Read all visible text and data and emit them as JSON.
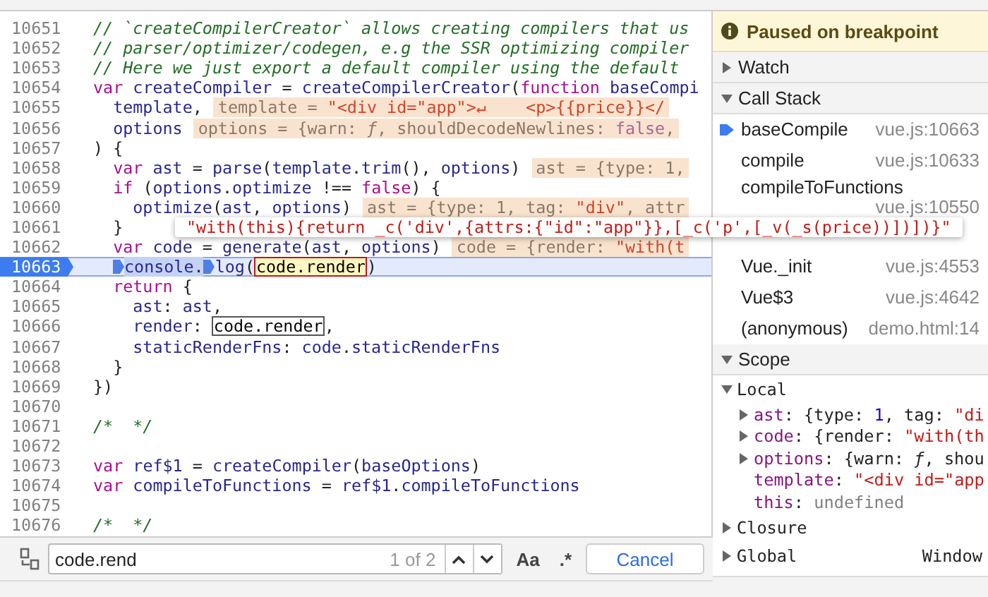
{
  "editor": {
    "lines": [
      {
        "number": "10651",
        "paused": false,
        "segments": [
          {
            "kind": "code",
            "tokens": [
              {
                "kind": "comment",
                "text": "// `createCompilerCreator` allows creating compilers that us"
              }
            ]
          }
        ]
      },
      {
        "number": "10652",
        "paused": false,
        "segments": [
          {
            "kind": "code",
            "tokens": [
              {
                "kind": "comment",
                "text": "// parser/optimizer/codegen, e.g the SSR optimizing compiler"
              }
            ]
          }
        ]
      },
      {
        "number": "10653",
        "paused": false,
        "segments": [
          {
            "kind": "code",
            "tokens": [
              {
                "kind": "comment",
                "text": "// Here we just export a default compiler using the default"
              }
            ]
          }
        ]
      },
      {
        "number": "10654",
        "paused": false,
        "segments": [
          {
            "kind": "code",
            "tokens": [
              {
                "kind": "keyword",
                "text": "var"
              },
              {
                "kind": "name",
                "text": " createCompiler"
              },
              {
                "kind": "plain",
                "text": " = "
              },
              {
                "kind": "name",
                "text": "createCompilerCreator"
              },
              {
                "kind": "plain",
                "text": "("
              },
              {
                "kind": "keyword",
                "text": "function"
              },
              {
                "kind": "name",
                "text": " baseCompi"
              }
            ]
          }
        ]
      },
      {
        "number": "10655",
        "paused": false,
        "segments": [
          {
            "kind": "code",
            "tokens": [
              {
                "kind": "name",
                "text": "  template"
              },
              {
                "kind": "plain",
                "text": ","
              }
            ]
          },
          {
            "kind": "hint",
            "tokens": [
              {
                "kind": "label",
                "text": "template = "
              },
              {
                "kind": "string",
                "text": "\"<div id=\"app\">↵    <p>{{price}}</"
              }
            ]
          }
        ]
      },
      {
        "number": "10656",
        "paused": false,
        "segments": [
          {
            "kind": "code",
            "tokens": [
              {
                "kind": "name",
                "text": "  options"
              }
            ]
          },
          {
            "kind": "hint",
            "tokens": [
              {
                "kind": "label",
                "text": "options = {warn: "
              },
              {
                "kind": "fn",
                "text": "ƒ"
              },
              {
                "kind": "label",
                "text": ", shouldDecodeNewlines: "
              },
              {
                "kind": "literal",
                "text": "false"
              },
              {
                "kind": "label",
                "text": ","
              }
            ]
          }
        ]
      },
      {
        "number": "10657",
        "paused": false,
        "segments": [
          {
            "kind": "code",
            "tokens": [
              {
                "kind": "plain",
                "text": ") {"
              }
            ]
          }
        ]
      },
      {
        "number": "10658",
        "paused": false,
        "segments": [
          {
            "kind": "code",
            "tokens": [
              {
                "kind": "keyword",
                "text": "  var"
              },
              {
                "kind": "name",
                "text": " ast"
              },
              {
                "kind": "plain",
                "text": " = "
              },
              {
                "kind": "name",
                "text": "parse"
              },
              {
                "kind": "plain",
                "text": "("
              },
              {
                "kind": "name",
                "text": "template"
              },
              {
                "kind": "plain",
                "text": "."
              },
              {
                "kind": "name",
                "text": "trim"
              },
              {
                "kind": "plain",
                "text": "(), "
              },
              {
                "kind": "name",
                "text": "options"
              },
              {
                "kind": "plain",
                "text": ")"
              }
            ]
          },
          {
            "kind": "hint",
            "tokens": [
              {
                "kind": "label",
                "text": "ast = {type: "
              },
              {
                "kind": "label",
                "text": "1"
              },
              {
                "kind": "label",
                "text": ","
              }
            ]
          }
        ]
      },
      {
        "number": "10659",
        "paused": false,
        "segments": [
          {
            "kind": "code",
            "tokens": [
              {
                "kind": "keyword",
                "text": "  if"
              },
              {
                "kind": "plain",
                "text": " ("
              },
              {
                "kind": "name",
                "text": "options"
              },
              {
                "kind": "plain",
                "text": "."
              },
              {
                "kind": "name",
                "text": "optimize"
              },
              {
                "kind": "plain",
                "text": " !== "
              },
              {
                "kind": "keyword",
                "text": "false"
              },
              {
                "kind": "plain",
                "text": ") {"
              }
            ]
          }
        ]
      },
      {
        "number": "10660",
        "paused": false,
        "segments": [
          {
            "kind": "code",
            "tokens": [
              {
                "kind": "name",
                "text": "    optimize"
              },
              {
                "kind": "plain",
                "text": "("
              },
              {
                "kind": "name",
                "text": "ast"
              },
              {
                "kind": "plain",
                "text": ", "
              },
              {
                "kind": "name",
                "text": "options"
              },
              {
                "kind": "plain",
                "text": ")"
              }
            ]
          },
          {
            "kind": "hint",
            "tokens": [
              {
                "kind": "label",
                "text": "ast = {type: 1, tag: "
              },
              {
                "kind": "string",
                "text": "\"div\""
              },
              {
                "kind": "label",
                "text": ", attr"
              }
            ]
          }
        ]
      },
      {
        "number": "10661",
        "paused": false,
        "segments": [
          {
            "kind": "code",
            "tokens": [
              {
                "kind": "plain",
                "text": "  }"
              }
            ]
          }
        ]
      },
      {
        "number": "10662",
        "paused": false,
        "segments": [
          {
            "kind": "code",
            "tokens": [
              {
                "kind": "keyword",
                "text": "  var"
              },
              {
                "kind": "name",
                "text": " code"
              },
              {
                "kind": "plain",
                "text": " = "
              },
              {
                "kind": "name",
                "text": "generate"
              },
              {
                "kind": "plain",
                "text": "("
              },
              {
                "kind": "name",
                "text": "ast"
              },
              {
                "kind": "plain",
                "text": ", "
              },
              {
                "kind": "name",
                "text": "options"
              },
              {
                "kind": "plain",
                "text": ")"
              }
            ]
          },
          {
            "kind": "hint",
            "tokens": [
              {
                "kind": "label",
                "text": "code = {render: "
              },
              {
                "kind": "string",
                "text": "\"with(t"
              }
            ]
          }
        ]
      },
      {
        "number": "10663",
        "paused": true,
        "segments": [
          {
            "kind": "marker"
          },
          {
            "kind": "exec",
            "tokens": [
              {
                "kind": "name",
                "text": "console"
              },
              {
                "kind": "plain",
                "text": "."
              }
            ]
          },
          {
            "kind": "marker"
          },
          {
            "kind": "code",
            "tokens": [
              {
                "kind": "name",
                "text": "log"
              },
              {
                "kind": "plain",
                "text": "("
              }
            ]
          },
          {
            "kind": "match",
            "current": true,
            "text": "code.render"
          },
          {
            "kind": "code",
            "tokens": [
              {
                "kind": "plain",
                "text": ")"
              }
            ]
          }
        ]
      },
      {
        "number": "10664",
        "paused": false,
        "segments": [
          {
            "kind": "code",
            "tokens": [
              {
                "kind": "keyword",
                "text": "  return"
              },
              {
                "kind": "plain",
                "text": " {"
              }
            ]
          }
        ]
      },
      {
        "number": "10665",
        "paused": false,
        "segments": [
          {
            "kind": "code",
            "tokens": [
              {
                "kind": "name",
                "text": "    ast"
              },
              {
                "kind": "plain",
                "text": ": "
              },
              {
                "kind": "name",
                "text": "ast"
              },
              {
                "kind": "plain",
                "text": ","
              }
            ]
          }
        ]
      },
      {
        "number": "10666",
        "paused": false,
        "segments": [
          {
            "kind": "code",
            "tokens": [
              {
                "kind": "name",
                "text": "    render"
              },
              {
                "kind": "plain",
                "text": ":"
              }
            ]
          },
          {
            "kind": "match",
            "current": false,
            "text": "code.render"
          },
          {
            "kind": "code",
            "tokens": [
              {
                "kind": "plain",
                "text": ","
              }
            ]
          }
        ]
      },
      {
        "number": "10667",
        "paused": false,
        "segments": [
          {
            "kind": "code",
            "tokens": [
              {
                "kind": "name",
                "text": "    staticRenderFns"
              },
              {
                "kind": "plain",
                "text": ": "
              },
              {
                "kind": "name",
                "text": "code"
              },
              {
                "kind": "plain",
                "text": "."
              },
              {
                "kind": "name",
                "text": "staticRenderFns"
              }
            ]
          }
        ]
      },
      {
        "number": "10668",
        "paused": false,
        "segments": [
          {
            "kind": "code",
            "tokens": [
              {
                "kind": "plain",
                "text": "  }"
              }
            ]
          }
        ]
      },
      {
        "number": "10669",
        "paused": false,
        "segments": [
          {
            "kind": "code",
            "tokens": [
              {
                "kind": "plain",
                "text": "})"
              }
            ]
          }
        ]
      },
      {
        "number": "10670",
        "paused": false
      },
      {
        "number": "10671",
        "paused": false,
        "segments": [
          {
            "kind": "code",
            "tokens": [
              {
                "kind": "comment",
                "text": "/*  */"
              }
            ]
          }
        ]
      },
      {
        "number": "10672",
        "paused": false
      },
      {
        "number": "10673",
        "paused": false,
        "segments": [
          {
            "kind": "code",
            "tokens": [
              {
                "kind": "keyword",
                "text": "var"
              },
              {
                "kind": "name",
                "text": " ref$1"
              },
              {
                "kind": "plain",
                "text": " = "
              },
              {
                "kind": "name",
                "text": "createCompiler"
              },
              {
                "kind": "plain",
                "text": "("
              },
              {
                "kind": "name",
                "text": "baseOptions"
              },
              {
                "kind": "plain",
                "text": ")"
              }
            ]
          }
        ]
      },
      {
        "number": "10674",
        "paused": false,
        "segments": [
          {
            "kind": "code",
            "tokens": [
              {
                "kind": "keyword",
                "text": "var"
              },
              {
                "kind": "name",
                "text": " compileToFunctions"
              },
              {
                "kind": "plain",
                "text": " = "
              },
              {
                "kind": "name",
                "text": "ref$1"
              },
              {
                "kind": "plain",
                "text": "."
              },
              {
                "kind": "name",
                "text": "compileToFunctions"
              }
            ]
          }
        ]
      },
      {
        "number": "10675",
        "paused": false
      },
      {
        "number": "10676",
        "paused": false,
        "segments": [
          {
            "kind": "code",
            "tokens": [
              {
                "kind": "comment",
                "text": "/*  */"
              }
            ]
          }
        ]
      }
    ]
  },
  "tooltip": {
    "text": "\"with(this){return _c('div',{attrs:{\"id\":\"app\"}},[_c('p',[_v(_s(price))])])}\""
  },
  "search": {
    "value": "code.rend",
    "count": "1 of 2",
    "case_button": "Aa",
    "regex_button": ".*",
    "cancel_button": "Cancel"
  },
  "debugger": {
    "banner": "Paused on breakpoint",
    "sections": [
      {
        "kind": "plain",
        "title": "Watch",
        "expanded": false
      },
      {
        "kind": "stack",
        "title": "Call Stack",
        "expanded": true,
        "frames": [
          {
            "kind": "frame",
            "name": "baseCompile",
            "location": "vue.js:10663",
            "selected": true
          },
          {
            "kind": "frame",
            "name": "compile",
            "location": "vue.js:10633",
            "selected": false
          },
          {
            "kind": "wrapped",
            "name": "compileToFunctions",
            "location": "vue.js:10550",
            "selected": false
          },
          {
            "kind": "covered"
          },
          {
            "kind": "frame",
            "name": "Vue._init",
            "location": "vue.js:4553",
            "selected": false
          },
          {
            "kind": "frame",
            "name": "Vue$3",
            "location": "vue.js:4642",
            "selected": false
          },
          {
            "kind": "frame",
            "name": "(anonymous)",
            "location": "demo.html:14",
            "selected": false
          }
        ]
      },
      {
        "kind": "scope",
        "title": "Scope",
        "expanded": true,
        "groups": [
          {
            "name": "Local",
            "expanded": true,
            "entries": [
              {
                "name": "ast",
                "expandable": true,
                "value": [
                  {
                    "kind": "plain",
                    "text": ": {type: "
                  },
                  {
                    "kind": "number",
                    "text": "1"
                  },
                  {
                    "kind": "plain",
                    "text": ", tag: "
                  },
                  {
                    "kind": "string",
                    "text": "\"di"
                  }
                ]
              },
              {
                "name": "code",
                "expandable": true,
                "value": [
                  {
                    "kind": "plain",
                    "text": ": {render: "
                  },
                  {
                    "kind": "string",
                    "text": "\"with(th"
                  }
                ]
              },
              {
                "name": "options",
                "expandable": true,
                "value": [
                  {
                    "kind": "plain",
                    "text": ": {warn: "
                  },
                  {
                    "kind": "fn",
                    "text": "ƒ"
                  },
                  {
                    "kind": "plain",
                    "text": ", shou"
                  }
                ]
              },
              {
                "name": "template",
                "expandable": false,
                "value": [
                  {
                    "kind": "plain",
                    "text": ":"
                  },
                  {
                    "kind": "string",
                    "text": " \"<div id=\"app"
                  }
                ]
              },
              {
                "name": "this",
                "expandable": false,
                "value": [
                  {
                    "kind": "plain",
                    "text": ":"
                  },
                  {
                    "kind": "undefined",
                    "text": " undefined"
                  }
                ]
              }
            ]
          },
          {
            "name": "Closure",
            "expanded": false
          },
          {
            "name": "Global",
            "expanded": false,
            "value": "Window"
          }
        ]
      }
    ]
  }
}
